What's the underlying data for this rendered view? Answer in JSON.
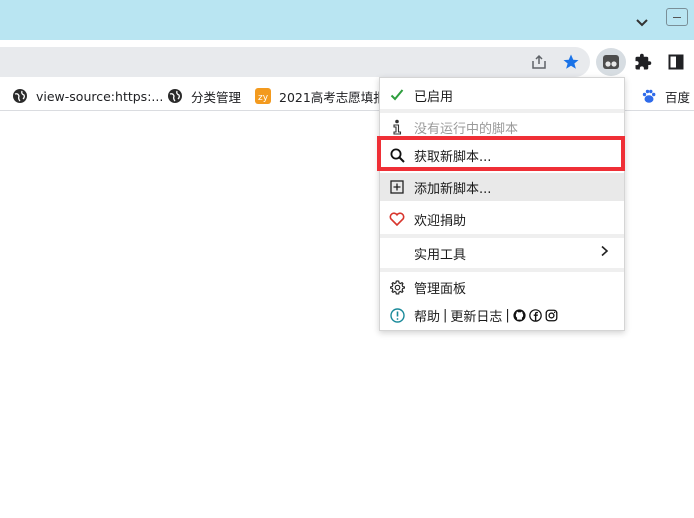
{
  "bookmarks": [
    {
      "label": "view-source:https:...",
      "icon": "globe-icon"
    },
    {
      "label": "分类管理",
      "icon": "globe-icon"
    },
    {
      "label": "2021高考志愿填报",
      "icon": "orange-app-icon"
    },
    {
      "label": "百度",
      "icon": "baidu-paw-icon"
    }
  ],
  "menu": {
    "enabled_label": "已启用",
    "no_scripts_label": "没有运行中的脚本",
    "get_scripts_label": "获取新脚本...",
    "add_script_label": "添加新脚本...",
    "donate_label": "欢迎捐助",
    "utilities_label": "实用工具",
    "dashboard_label": "管理面板",
    "help_label": "帮助",
    "sep1": "|",
    "changelog_label": "更新日志",
    "sep2": "|"
  },
  "colors": {
    "titlebar": "#b9e5f2",
    "highlight": "#ef2f36",
    "check": "#2e9e3e",
    "heart": "#d8362d",
    "star": "#1a73e8"
  }
}
